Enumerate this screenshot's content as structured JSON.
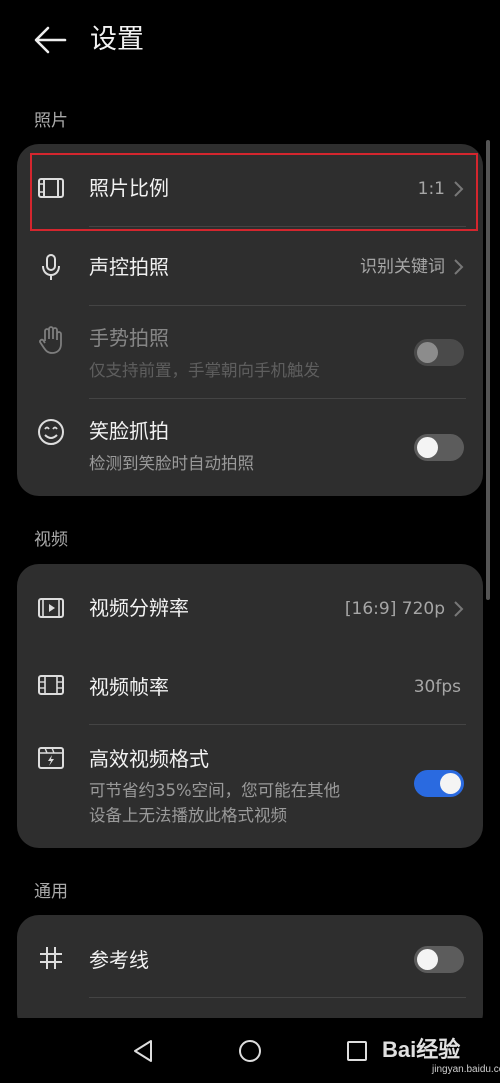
{
  "header": {
    "title": "设置"
  },
  "sections": {
    "photo": {
      "label": "照片",
      "rows": {
        "ratio": {
          "title": "照片比例",
          "value": "1:1"
        },
        "voice": {
          "title": "声控拍照",
          "value": "识别关键词"
        },
        "gesture": {
          "title": "手势拍照",
          "subtitle": "仅支持前置，手掌朝向手机触发",
          "enabled": false
        },
        "smile": {
          "title": "笑脸抓拍",
          "subtitle": "检测到笑脸时自动拍照",
          "toggle": false
        }
      }
    },
    "video": {
      "label": "视频",
      "rows": {
        "resolution": {
          "title": "视频分辨率",
          "value": "[16:9] 720p"
        },
        "framerate": {
          "title": "视频帧率",
          "value": "30fps"
        },
        "efficient": {
          "title": "高效视频格式",
          "subtitle_line1": "可节省约35%空间，您可能在其他",
          "subtitle_line2": "设备上无法播放此格式视频",
          "toggle": true
        }
      }
    },
    "general": {
      "label": "通用",
      "rows": {
        "gridlines": {
          "title": "参考线",
          "toggle": false
        }
      }
    }
  },
  "watermark": {
    "brand": "Bai经验",
    "url": "jingyan.baidu.com"
  },
  "colors": {
    "accent": "#2a6ae0",
    "highlight": "#d4262e",
    "card": "#2e2e2e",
    "background": "#000000"
  },
  "icons": {
    "back": "arrow-left-icon",
    "ratio": "film-frame-icon",
    "voice": "microphone-icon",
    "gesture": "hand-icon",
    "smile": "smile-icon",
    "resolution": "video-play-frame-icon",
    "framerate": "film-strip-icon",
    "efficient": "video-flash-icon",
    "gridlines": "hash-icon"
  }
}
